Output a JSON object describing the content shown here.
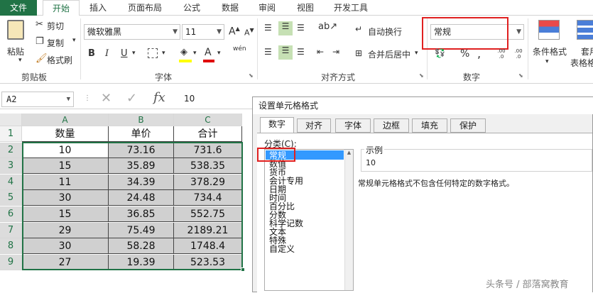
{
  "menu": {
    "tabs": [
      "文件",
      "开始",
      "插入",
      "页面布局",
      "公式",
      "数据",
      "审阅",
      "视图",
      "开发工具"
    ]
  },
  "ribbon": {
    "clipboard": {
      "paste": "粘贴",
      "cut": "剪切",
      "copy": "复制",
      "format_painter": "格式刷",
      "group_label": "剪贴板"
    },
    "font": {
      "font_name": "微软雅黑",
      "font_size": "11",
      "bold": "B",
      "italic": "I",
      "underline": "U",
      "grow": "A",
      "shrink": "A",
      "phonetic": "wén",
      "group_label": "字体"
    },
    "alignment": {
      "wrap_text": "自动换行",
      "merge_center": "合并后居中",
      "group_label": "对齐方式"
    },
    "number": {
      "format_value": "常规",
      "percent": "%",
      "comma": ",",
      "inc_decimal": ".00 .0",
      "dec_decimal": ".00 .0",
      "group_label": "数字"
    },
    "styles": {
      "conditional_format": "条件格式",
      "table_format_line1": "套用",
      "table_format_line2": "表格格"
    }
  },
  "formula_bar": {
    "name_box": "A2",
    "fx": "fx",
    "value": "10"
  },
  "sheet": {
    "columns": [
      "A",
      "B",
      "C"
    ],
    "rows": [
      "1",
      "2",
      "3",
      "4",
      "5",
      "6",
      "7",
      "8",
      "9"
    ],
    "header": [
      "数量",
      "单价",
      "合计"
    ],
    "data": [
      [
        "10",
        "73.16",
        "731.6"
      ],
      [
        "15",
        "35.89",
        "538.35"
      ],
      [
        "11",
        "34.39",
        "378.29"
      ],
      [
        "30",
        "24.48",
        "734.4"
      ],
      [
        "15",
        "36.85",
        "552.75"
      ],
      [
        "29",
        "75.49",
        "2189.21"
      ],
      [
        "30",
        "58.28",
        "1748.4"
      ],
      [
        "27",
        "19.39",
        "523.53"
      ]
    ]
  },
  "dialog": {
    "title": "设置单元格格式",
    "tabs": [
      "数字",
      "对齐",
      "字体",
      "边框",
      "填充",
      "保护"
    ],
    "category_label": "分类(C):",
    "categories": [
      "常规",
      "数值",
      "货币",
      "会计专用",
      "日期",
      "时间",
      "百分比",
      "分数",
      "科学记数",
      "文本",
      "特殊",
      "自定义"
    ],
    "sample_label": "示例",
    "sample_value": "10",
    "description": "常规单元格格式不包含任何特定的数字格式。"
  },
  "watermark": "头条号 / 部落窝教育",
  "colors": {
    "excel_green": "#217346",
    "highlight_red": "#e02020",
    "selection_gray": "#d0d0d0"
  }
}
